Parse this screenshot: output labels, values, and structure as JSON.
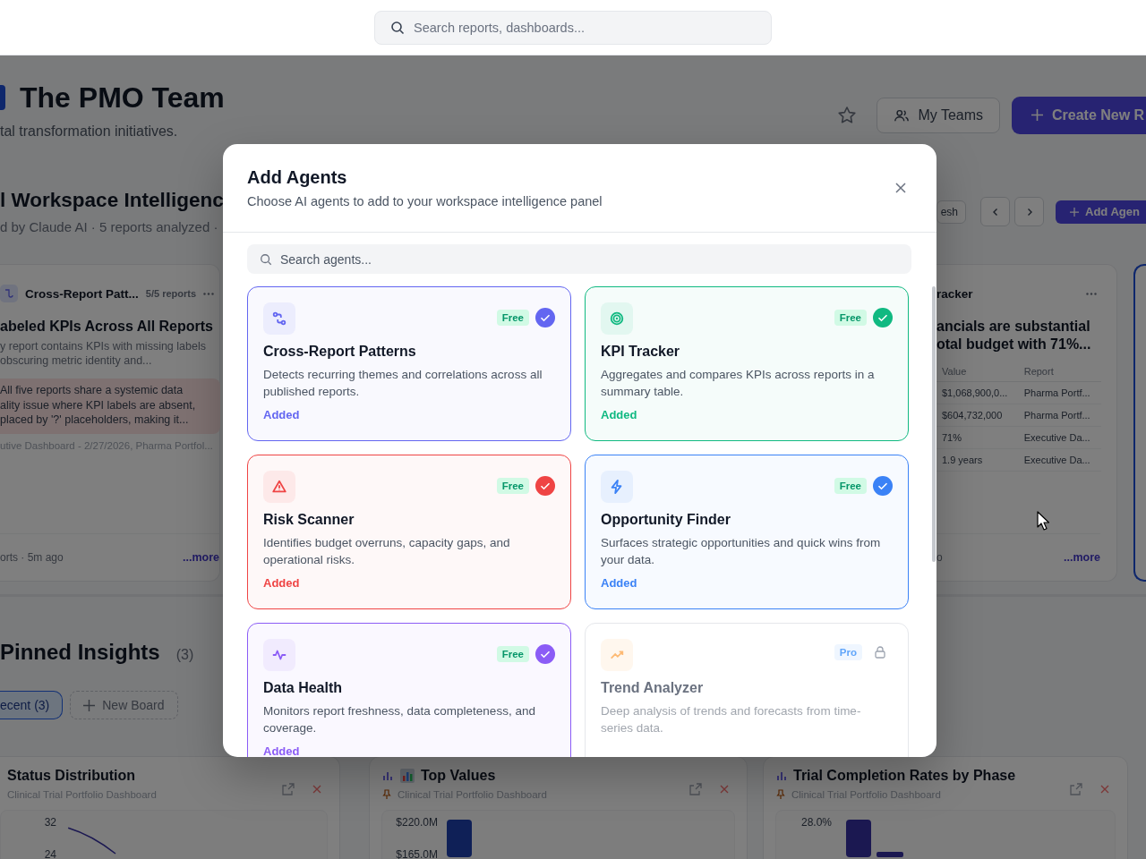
{
  "top_bar": {
    "search_placeholder": "Search reports, dashboards..."
  },
  "header": {
    "title": "The PMO Team",
    "subtitle": "tal transformation initiatives.",
    "my_teams": "My Teams",
    "create": "Create New R"
  },
  "intelligence": {
    "title": "l Workspace Intelligenc",
    "subtitle": "d by Claude AI · 5 reports analyzed ·",
    "refresh": "esh",
    "add_agent": "Add Agen"
  },
  "left_card": {
    "agent": "Cross-Report Patt...",
    "meta": "5/5 reports",
    "title": "abeled KPIs Across All Reports",
    "description_lines": [
      "y report contains KPIs with missing labels",
      "obscuring metric identity and..."
    ],
    "highlight_lines": [
      "All five reports share a systemic data",
      "ality issue where KPI labels are absent,",
      "placed by '?' placeholders, making it..."
    ],
    "sources": "utive Dashboard - 2/27/2026, Pharma Portfol...",
    "footer": "orts · 5m ago",
    "more": "...more"
  },
  "right_card": {
    "agent": "racker",
    "title_lines": [
      "ancials are substantial",
      "otal budget with 71%..."
    ],
    "columns": [
      "Value",
      "Report"
    ],
    "rows": [
      [
        "$1,068,900,0...",
        "Pharma Portf..."
      ],
      [
        "$604,732,000",
        "Pharma Portf..."
      ],
      [
        "71%",
        "Executive Da..."
      ],
      [
        "1.9 years",
        "Executive Da..."
      ]
    ],
    "footer": "o",
    "more": "...more"
  },
  "pinned": {
    "title": "Pinned Insights",
    "count": "(3)",
    "tabs": [
      {
        "label": "ecent (3)",
        "selected": true
      }
    ],
    "new_board": "New Board"
  },
  "charts": [
    {
      "kind": "line",
      "title": "Status Distribution",
      "source": "Clinical Trial Portfolio Dashboard",
      "tick_labels": [
        "32",
        "24"
      ]
    },
    {
      "kind": "bar",
      "title": "Top Values",
      "source": "Clinical Trial Portfolio Dashboard",
      "tick_labels": [
        "$220.0M",
        "$165.0M"
      ]
    },
    {
      "kind": "bar",
      "title": "Trial Completion Rates by Phase",
      "source": "Clinical Trial Portfolio Dashboard",
      "tick_labels": [
        "28.0%"
      ]
    }
  ],
  "modal": {
    "title": "Add Agents",
    "subtitle": "Choose AI agents to add to your workspace intelligence panel",
    "search_placeholder": "Search agents...",
    "agents": [
      {
        "kind": "patterns",
        "name": "Cross-Report Patterns",
        "description": "Detects recurring themes and correlations across all published reports.",
        "badge": {
          "label": "Free",
          "kind": "free"
        },
        "added": true,
        "locked": false,
        "status": "Added",
        "color": "#6366f1"
      },
      {
        "kind": "kpi",
        "name": "KPI Tracker",
        "description": "Aggregates and compares KPIs across reports in a summary table.",
        "badge": {
          "label": "Free",
          "kind": "free"
        },
        "added": true,
        "locked": false,
        "status": "Added",
        "color": "#10b981"
      },
      {
        "kind": "risk",
        "name": "Risk Scanner",
        "description": "Identifies budget overruns, capacity gaps, and operational risks.",
        "badge": {
          "label": "Free",
          "kind": "free"
        },
        "added": true,
        "locked": false,
        "status": "Added",
        "color": "#ef4444"
      },
      {
        "kind": "opportunity",
        "name": "Opportunity Finder",
        "description": "Surfaces strategic opportunities and quick wins from your data.",
        "badge": {
          "label": "Free",
          "kind": "free"
        },
        "added": true,
        "locked": false,
        "status": "Added",
        "color": "#3b82f6"
      },
      {
        "kind": "health",
        "name": "Data Health",
        "description": "Monitors report freshness, data completeness, and coverage.",
        "badge": {
          "label": "Free",
          "kind": "free"
        },
        "added": true,
        "locked": false,
        "status": "Added",
        "color": "#8b5cf6"
      },
      {
        "kind": "trend",
        "name": "Trend Analyzer",
        "description": "Deep analysis of trends and forecasts from time-series data.",
        "badge": {
          "label": "Pro",
          "kind": "pro"
        },
        "added": false,
        "locked": true,
        "color": "#fdba74"
      }
    ]
  }
}
